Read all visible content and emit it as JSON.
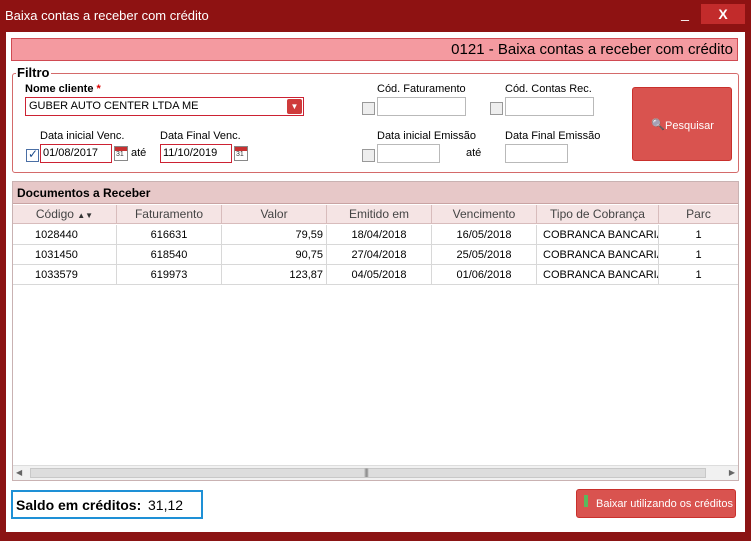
{
  "window": {
    "title": "Baixa contas a receber com crédito",
    "minimize_label": "_",
    "close_label": "X"
  },
  "header": {
    "title": "0121 - Baixa contas a receber com crédito"
  },
  "filtro": {
    "legend": "Filtro",
    "nome_cliente": {
      "label": "Nome cliente",
      "required_mark": "*",
      "value": "GUBER AUTO CENTER LTDA ME"
    },
    "cod_faturamento": {
      "label": "Cód. Faturamento",
      "value": "",
      "checked": false
    },
    "cod_contas_rec": {
      "label": "Cód. Contas Rec.",
      "value": "",
      "checked": false
    },
    "data_inicial_venc": {
      "label": "Data inicial Venc.",
      "value": "01/08/2017",
      "checked": true
    },
    "ate_label": "até",
    "data_final_venc": {
      "label": "Data Final Venc.",
      "value": "11/10/2019"
    },
    "data_inicial_emissao": {
      "label": "Data inicial Emissão",
      "value": "",
      "checked": false
    },
    "data_final_emissao": {
      "label": "Data Final Emissão",
      "value": ""
    },
    "pesquisar_button": "Pesquisar"
  },
  "documentos": {
    "title": "Documentos a Receber",
    "columns": [
      "Código",
      "Faturamento",
      "Valor",
      "Emitido em",
      "Vencimento",
      "Tipo de Cobrança",
      "Parc"
    ],
    "rows": [
      {
        "codigo": "1028440",
        "faturamento": "616631",
        "valor": "79,59",
        "emitido": "18/04/2018",
        "vencimento": "16/05/2018",
        "tipo": "COBRANCA BANCARIA",
        "parc": "1"
      },
      {
        "codigo": "1031450",
        "faturamento": "618540",
        "valor": "90,75",
        "emitido": "27/04/2018",
        "vencimento": "25/05/2018",
        "tipo": "COBRANCA BANCARIA",
        "parc": "1"
      },
      {
        "codigo": "1033579",
        "faturamento": "619973",
        "valor": "123,87",
        "emitido": "04/05/2018",
        "vencimento": "01/06/2018",
        "tipo": "COBRANCA BANCARIA",
        "parc": "1"
      }
    ]
  },
  "footer": {
    "saldo_label": "Saldo em créditos:",
    "saldo_value": "31,12",
    "baixar_button": "Baixar utilizando os créditos"
  },
  "colors": {
    "frame": "#8e1212",
    "accent": "#d9534f",
    "header_bg": "#f49aa0",
    "highlight_border": "#1e90d6"
  },
  "icons": [
    "search-icon",
    "calendar-icon",
    "sort-icon",
    "dropdown-arrow-icon",
    "exclamation-icon",
    "close-icon"
  ]
}
